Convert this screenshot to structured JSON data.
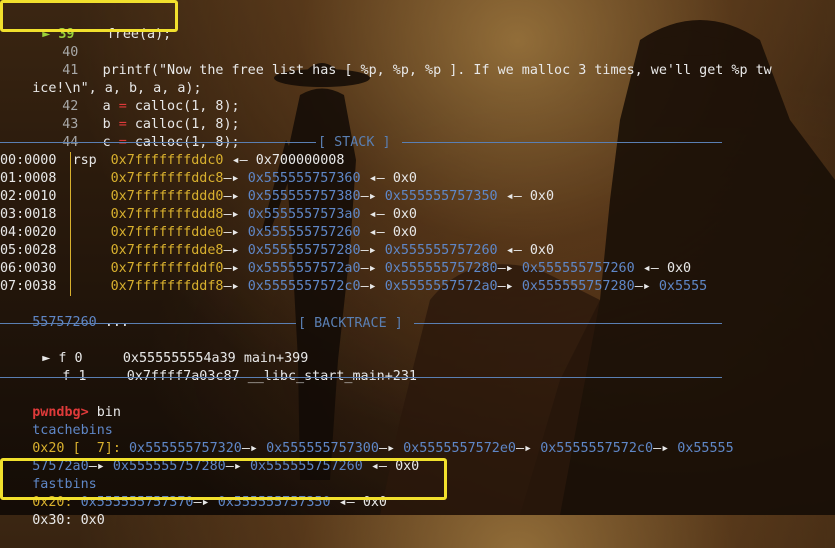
{
  "source": {
    "current": {
      "num": "39",
      "code": "free(a);"
    },
    "lines": [
      {
        "num": "40",
        "code": ""
      },
      {
        "num": "41",
        "code": "printf(\"Now the free list has [ %p, %p, %p ]. If we malloc 3 times, we'll get %p tw"
      },
      {
        "num": "",
        "code": "ice!\\n\", a, b, a, a);"
      },
      {
        "num": "42",
        "var": "a",
        "rhs": "calloc(1, 8);"
      },
      {
        "num": "43",
        "var": "b",
        "rhs": "calloc(1, 8);"
      },
      {
        "num": "44",
        "var": "c",
        "rhs": "calloc(1, 8);"
      }
    ]
  },
  "stack": {
    "title": "[ STACK ]",
    "rows": [
      {
        "idx": "00:0000",
        "reg": "rsp",
        "addr": "0x7fffffffddc0",
        "chain": [
          {
            "v": "0x700000008",
            "c": "white"
          }
        ]
      },
      {
        "idx": "01:0008",
        "reg": "",
        "addr": "0x7fffffffddc8",
        "chain": [
          {
            "v": "0x555555757360",
            "c": "blue"
          },
          {
            "v": "0x0",
            "c": "white"
          }
        ]
      },
      {
        "idx": "02:0010",
        "reg": "",
        "addr": "0x7fffffffddd0",
        "chain": [
          {
            "v": "0x555555757380",
            "c": "blue"
          },
          {
            "v": "0x555555757350",
            "c": "blue"
          },
          {
            "v": "0x0",
            "c": "white"
          }
        ]
      },
      {
        "idx": "03:0018",
        "reg": "",
        "addr": "0x7fffffffddd8",
        "chain": [
          {
            "v": "0x5555557573a0",
            "c": "blue"
          },
          {
            "v": "0x0",
            "c": "white"
          }
        ]
      },
      {
        "idx": "04:0020",
        "reg": "",
        "addr": "0x7fffffffdde0",
        "chain": [
          {
            "v": "0x555555757260",
            "c": "blue"
          },
          {
            "v": "0x0",
            "c": "white"
          }
        ]
      },
      {
        "idx": "05:0028",
        "reg": "",
        "addr": "0x7fffffffdde8",
        "chain": [
          {
            "v": "0x555555757280",
            "c": "blue"
          },
          {
            "v": "0x555555757260",
            "c": "blue"
          },
          {
            "v": "0x0",
            "c": "white"
          }
        ]
      },
      {
        "idx": "06:0030",
        "reg": "",
        "addr": "0x7fffffffddf0",
        "chain": [
          {
            "v": "0x5555557572a0",
            "c": "blue"
          },
          {
            "v": "0x555555757280",
            "c": "blue"
          },
          {
            "v": "0x555555757260",
            "c": "blue"
          },
          {
            "v": "0x0",
            "c": "white"
          }
        ]
      },
      {
        "idx": "07:0038",
        "reg": "",
        "addr": "0x7fffffffddf8",
        "chain": [
          {
            "v": "0x5555557572c0",
            "c": "blue"
          },
          {
            "v": "0x5555557572a0",
            "c": "blue"
          },
          {
            "v": "0x555555757280",
            "c": "blue"
          },
          {
            "v": "0x5555",
            "c": "blue"
          }
        ]
      }
    ],
    "wrap": "55757260",
    "wrap_tail": "..."
  },
  "backtrace": {
    "title": "[ BACKTRACE ]",
    "frames": [
      {
        "marker": "►",
        "frame": "f 0",
        "addr": "0x555555554a39",
        "sym": "main+399"
      },
      {
        "marker": "",
        "frame": "f 1",
        "addr": "0x7ffff7a03c87",
        "sym": "__libc_start_main+231"
      }
    ]
  },
  "prompt": {
    "name": "pwndbg>",
    "command": "bin"
  },
  "tcachebins": {
    "label": "tcachebins",
    "size": "0x20",
    "count": "[  7]:",
    "chain1": [
      "0x555555757320",
      "0x555555757300",
      "0x5555557572e0",
      "0x5555557572c0",
      "0x55555"
    ],
    "chain2": [
      "57572a0",
      "0x555555757280",
      "0x555555757260",
      "0x0"
    ]
  },
  "fastbins": {
    "label": "fastbins",
    "size": "0x20:",
    "chain": [
      "0x555555757370",
      "0x555555757350",
      "0x0"
    ],
    "next": "0x30: 0x0"
  },
  "arrow": "—▸",
  "left_arrow": "◂—",
  "colors": {
    "highlight": "#f1e02d",
    "addr_yellow": "#d8b02e",
    "heap_blue": "#5f87c7",
    "prompt_red": "#e03a3a",
    "separator": "#5a7fb3"
  }
}
